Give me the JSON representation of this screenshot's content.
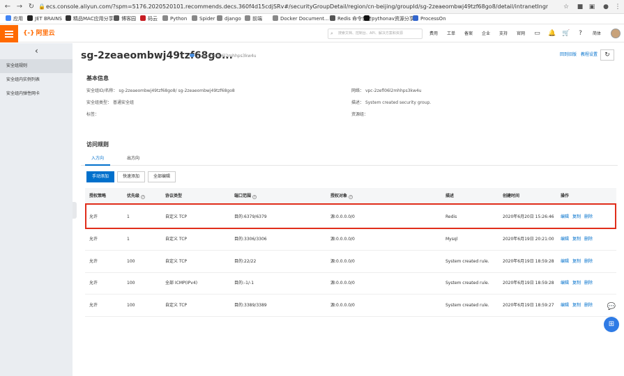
{
  "browser": {
    "url": "ecs.console.aliyun.com/?spm=5176.2020520101.recommends.decs.360f4d15cdjSRv#/securityGroupDetail/region/cn-beijing/groupId/sg-2zeaeombwj49tzf68go8/detail/intranetIngress",
    "bookmarks": [
      "应用",
      "JET BRAINS",
      "精品MAC应用分享",
      "博客园",
      "码云",
      "Python",
      "Spider",
      "django",
      "前端",
      "Docker Document...",
      "Redis 命令参考",
      "pythonav资源分享",
      "ProcessOn"
    ],
    "colors": {
      "bookmarks": [
        "#4285f4",
        "#222222",
        "#333333",
        "#555555",
        "#c71d23",
        "#888888",
        "#888888",
        "#888888",
        "#888888",
        "#888888",
        "#555555",
        "#111111",
        "#3366cc"
      ]
    }
  },
  "topbar": {
    "logo": "阿里云",
    "search_placeholder": "搜索文档、控制台、API、解决方案和资源",
    "links": [
      "费用",
      "工单",
      "备案",
      "企业",
      "支持",
      "官网"
    ],
    "lang": "简体"
  },
  "sidebar": {
    "items": [
      "安全组规则",
      "安全组内实例列表",
      "安全组内弹性网卡"
    ]
  },
  "header": {
    "title": "sg-2zeaeombwj49tzf68go...",
    "vpc": "/ vpc-2zefl06l2mhhps3kw4u",
    "links": [
      "回到旧版",
      "教程设置"
    ]
  },
  "basic_info": {
    "title": "基本信息",
    "left": [
      {
        "label": "安全组ID/名称：",
        "value": "sg-2zeaeombwj49tzf68go8/ sg-2zeaeombwj49tzf68go8"
      },
      {
        "label": "安全组类型：",
        "value": "普通安全组"
      },
      {
        "label": "标签：",
        "value": ""
      }
    ],
    "right": [
      {
        "label": "网络：",
        "value": "vpc-2zefl06l2mhhps3kw4u"
      },
      {
        "label": "描述：",
        "value": "System created security group."
      },
      {
        "label": "资源组：",
        "value": ""
      }
    ]
  },
  "access_rules": {
    "title": "访问规则",
    "tabs": [
      "入方向",
      "出方向"
    ],
    "buttons": [
      "手动添加",
      "快速添加",
      "全部编辑"
    ],
    "columns": [
      "授权策略",
      "优先级",
      "协议类型",
      "端口范围",
      "授权对象",
      "描述",
      "创建时间",
      "操作"
    ],
    "actions": [
      "编辑",
      "复制",
      "删除"
    ],
    "rows": [
      {
        "policy": "允许",
        "priority": "1",
        "protocol": "自定义 TCP",
        "port": "目的:6379/6379",
        "source": "源:0.0.0.0/0",
        "desc": "Redis",
        "time": "2020年6月20日 15:26:46"
      },
      {
        "policy": "允许",
        "priority": "1",
        "protocol": "自定义 TCP",
        "port": "目的:3306/3306",
        "source": "源:0.0.0.0/0",
        "desc": "Mysql",
        "time": "2020年6月19日 20:21:00"
      },
      {
        "policy": "允许",
        "priority": "100",
        "protocol": "自定义 TCP",
        "port": "目的:22/22",
        "source": "源:0.0.0.0/0",
        "desc": "System created rule.",
        "time": "2020年6月19日 18:59:28"
      },
      {
        "policy": "允许",
        "priority": "100",
        "protocol": "全部 ICMP(IPv4)",
        "port": "目的:-1/-1",
        "source": "源:0.0.0.0/0",
        "desc": "System created rule.",
        "time": "2020年6月19日 18:59:28"
      },
      {
        "policy": "允许",
        "priority": "100",
        "protocol": "自定义 TCP",
        "port": "目的:3389/3389",
        "source": "源:0.0.0.0/0",
        "desc": "System created rule.",
        "time": "2020年6月19日 18:59:27"
      }
    ]
  },
  "colors": {
    "accent": "#ff6a00",
    "link": "#0070cc",
    "highlight": "#e02d1a"
  }
}
